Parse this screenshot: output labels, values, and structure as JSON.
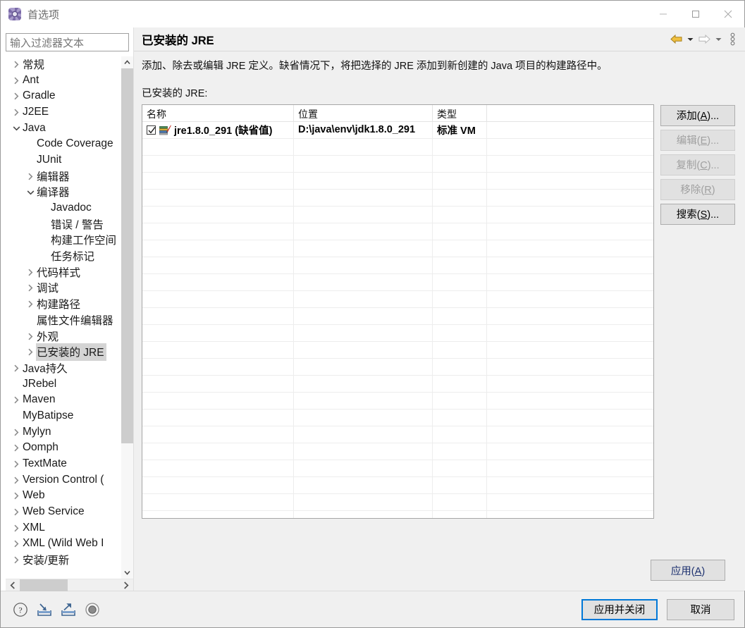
{
  "window": {
    "title": "首选项",
    "icon": "gear-icon",
    "controls": {
      "minimize": "minimize-icon",
      "maximize": "maximize-icon",
      "close": "close-icon"
    }
  },
  "filter": {
    "placeholder": "输入过滤器文本",
    "value": ""
  },
  "tree": {
    "items": [
      {
        "label": "常规",
        "indent": 0,
        "twisty": "collapsed",
        "selected": false
      },
      {
        "label": "Ant",
        "indent": 0,
        "twisty": "collapsed",
        "selected": false
      },
      {
        "label": "Gradle",
        "indent": 0,
        "twisty": "collapsed",
        "selected": false
      },
      {
        "label": "J2EE",
        "indent": 0,
        "twisty": "collapsed",
        "selected": false
      },
      {
        "label": "Java",
        "indent": 0,
        "twisty": "expanded",
        "selected": false
      },
      {
        "label": "Code Coverage",
        "indent": 1,
        "twisty": "none",
        "selected": false
      },
      {
        "label": "JUnit",
        "indent": 1,
        "twisty": "none",
        "selected": false
      },
      {
        "label": "编辑器",
        "indent": 1,
        "twisty": "collapsed",
        "selected": false
      },
      {
        "label": "编译器",
        "indent": 1,
        "twisty": "expanded",
        "selected": false
      },
      {
        "label": "Javadoc",
        "indent": 2,
        "twisty": "none",
        "selected": false
      },
      {
        "label": "错误 / 警告",
        "indent": 2,
        "twisty": "none",
        "selected": false
      },
      {
        "label": "构建工作空间",
        "indent": 2,
        "twisty": "none",
        "selected": false
      },
      {
        "label": "任务标记",
        "indent": 2,
        "twisty": "none",
        "selected": false
      },
      {
        "label": "代码样式",
        "indent": 1,
        "twisty": "collapsed",
        "selected": false
      },
      {
        "label": "调试",
        "indent": 1,
        "twisty": "collapsed",
        "selected": false
      },
      {
        "label": "构建路径",
        "indent": 1,
        "twisty": "collapsed",
        "selected": false
      },
      {
        "label": "属性文件编辑器",
        "indent": 1,
        "twisty": "none",
        "selected": false
      },
      {
        "label": "外观",
        "indent": 1,
        "twisty": "collapsed",
        "selected": false
      },
      {
        "label": "已安装的 JRE",
        "indent": 1,
        "twisty": "collapsed",
        "selected": true
      },
      {
        "label": "Java持久",
        "indent": 0,
        "twisty": "collapsed",
        "selected": false
      },
      {
        "label": "JRebel",
        "indent": 0,
        "twisty": "none",
        "selected": false
      },
      {
        "label": "Maven",
        "indent": 0,
        "twisty": "collapsed",
        "selected": false
      },
      {
        "label": "MyBatipse",
        "indent": 0,
        "twisty": "none",
        "selected": false
      },
      {
        "label": "Mylyn",
        "indent": 0,
        "twisty": "collapsed",
        "selected": false
      },
      {
        "label": "Oomph",
        "indent": 0,
        "twisty": "collapsed",
        "selected": false
      },
      {
        "label": "TextMate",
        "indent": 0,
        "twisty": "collapsed",
        "selected": false
      },
      {
        "label": "Version Control (",
        "indent": 0,
        "twisty": "collapsed",
        "selected": false
      },
      {
        "label": "Web",
        "indent": 0,
        "twisty": "collapsed",
        "selected": false
      },
      {
        "label": "Web Service",
        "indent": 0,
        "twisty": "collapsed",
        "selected": false
      },
      {
        "label": "XML",
        "indent": 0,
        "twisty": "collapsed",
        "selected": false
      },
      {
        "label": "XML (Wild Web I",
        "indent": 0,
        "twisty": "collapsed",
        "selected": false
      },
      {
        "label": "安装/更新",
        "indent": 0,
        "twisty": "collapsed",
        "selected": false
      }
    ]
  },
  "header": {
    "page_title": "已安装的 JRE",
    "back_icon": "back-arrow-icon",
    "back_dropdown_icon": "chevron-down-icon",
    "forward_icon": "forward-arrow-icon",
    "forward_dropdown_icon": "chevron-down-icon",
    "menu_icon": "vertical-dots-menu-icon"
  },
  "main": {
    "description": "添加、除去或编辑 JRE 定义。缺省情况下，将把选择的 JRE 添加到新创建的 Java 项目的构建路径中。",
    "list_label": "已安装的 JRE:",
    "table": {
      "columns": [
        "名称",
        "位置",
        "类型",
        ""
      ],
      "rows": [
        {
          "checked": true,
          "icon": "jre-library-icon",
          "name": "jre1.8.0_291 (缺省值)",
          "location": "D:\\java\\env\\jdk1.8.0_291",
          "type": "标准 VM",
          "extra": ""
        }
      ],
      "empty_row_count": 23
    },
    "buttons": [
      {
        "label": "添加(A)...",
        "mnemonic": "A",
        "enabled": true,
        "name": "add-button"
      },
      {
        "label": "编辑(E)...",
        "mnemonic": "E",
        "enabled": false,
        "name": "edit-button"
      },
      {
        "label": "复制(C)...",
        "mnemonic": "C",
        "enabled": false,
        "name": "duplicate-button"
      },
      {
        "label": "移除(R)",
        "mnemonic": "R",
        "enabled": false,
        "name": "remove-button"
      },
      {
        "label": "搜索(S)...",
        "mnemonic": "S",
        "enabled": true,
        "name": "search-button"
      }
    ],
    "apply_label": "应用(A)"
  },
  "footer": {
    "icons": [
      {
        "name": "help-icon"
      },
      {
        "name": "import-icon"
      },
      {
        "name": "export-icon"
      },
      {
        "name": "restore-defaults-icon"
      }
    ],
    "apply_and_close_label": "应用并关闭",
    "cancel_label": "取消"
  },
  "colors": {
    "accent": "#0078d7",
    "selection": "#d4d4d4",
    "apply_text": "#1b2f6e",
    "window_bg": "#f0f0f0",
    "field_bg": "#ffffff"
  }
}
